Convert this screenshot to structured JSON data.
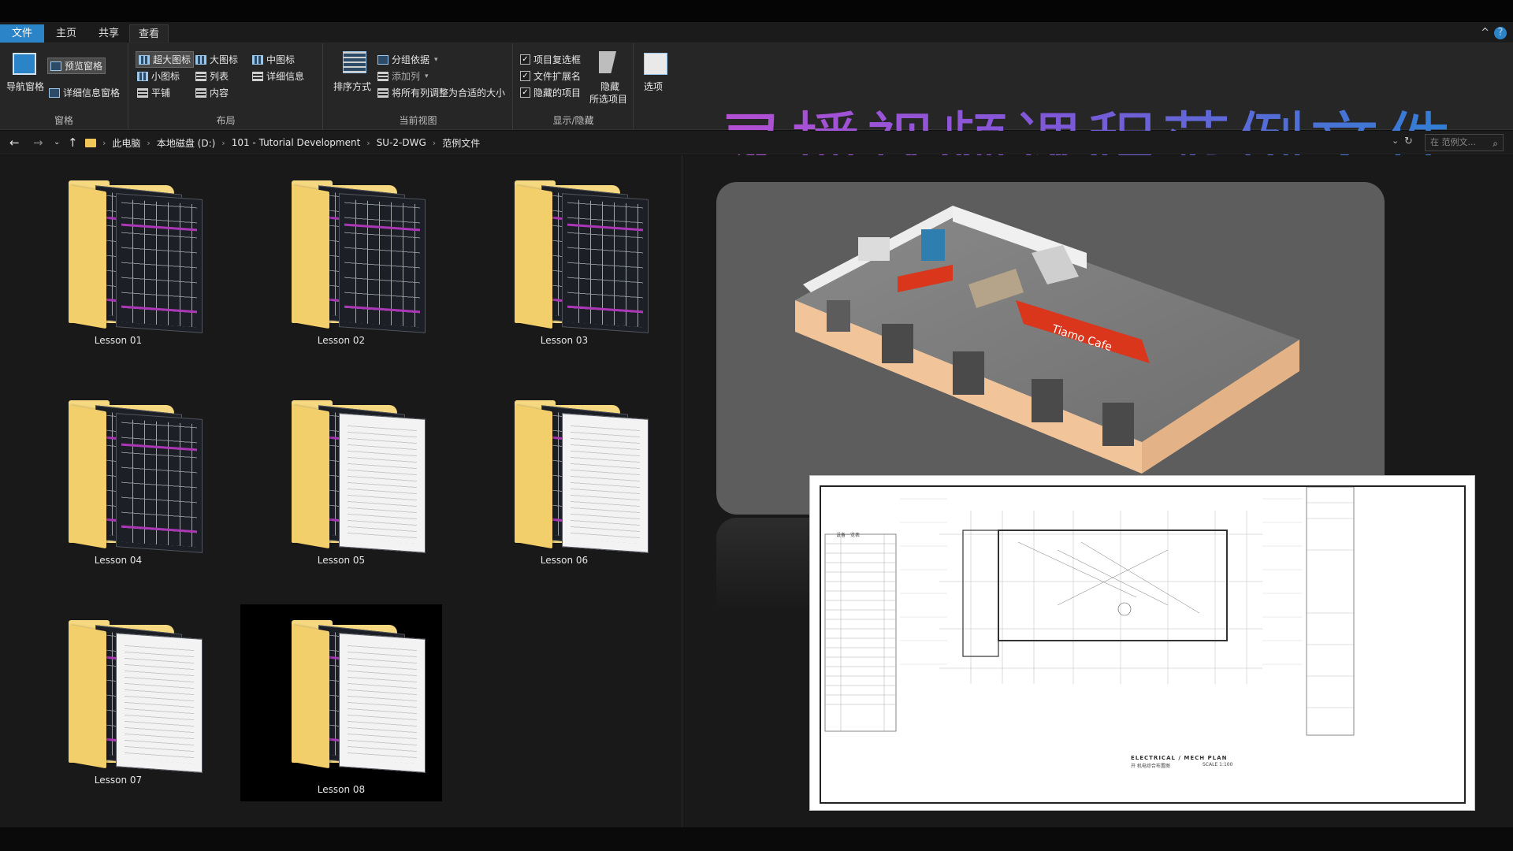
{
  "window": {
    "tabs": [
      {
        "label": "文件"
      },
      {
        "label": "主页"
      },
      {
        "label": "共享"
      },
      {
        "label": "查看"
      }
    ],
    "help_label": "?",
    "collapse_label": "^"
  },
  "ribbon": {
    "pane_group": {
      "label": "窗格",
      "nav_pane": "导航窗格",
      "preview_pane": "预览窗格",
      "details_pane": "详细信息窗格"
    },
    "layout_group": {
      "label": "布局",
      "items": [
        "超大图标",
        "大图标",
        "中图标",
        "小图标",
        "列表",
        "详细信息",
        "平铺",
        "内容"
      ]
    },
    "current_view_group": {
      "label": "当前视图",
      "sort_by": "排序方式",
      "group_by": "分组依据",
      "add_columns": "添加列",
      "size_all_columns": "将所有列调整为合适的大小"
    },
    "show_hide_group": {
      "label": "显示/隐藏",
      "item_checkboxes": "项目复选框",
      "file_extensions": "文件扩展名",
      "hidden_items": "隐藏的项目",
      "hide_selected": "隐藏",
      "hide_selected_sub": "所选项目"
    },
    "options": "选项"
  },
  "banner_text": "录播视频课程范例文件",
  "address": {
    "crumbs": [
      "此电脑",
      "本地磁盘 (D:)",
      "101 - Tutorial Development",
      "SU-2-DWG",
      "范例文件"
    ],
    "search_placeholder": "在 范例文..."
  },
  "folders": [
    {
      "label": "Lesson 01",
      "variant": "cad"
    },
    {
      "label": "Lesson 02",
      "variant": "cad"
    },
    {
      "label": "Lesson 03",
      "variant": "cad"
    },
    {
      "label": "Lesson 04",
      "variant": "cad"
    },
    {
      "label": "Lesson 05",
      "variant": "paper"
    },
    {
      "label": "Lesson 06",
      "variant": "paper"
    },
    {
      "label": "Lesson 07",
      "variant": "paper"
    },
    {
      "label": "Lesson 08",
      "variant": "paper",
      "selected": true
    }
  ],
  "preview": {
    "render_sign": "Tiamo Cafe",
    "drawing_title": "ELECTRICAL / MECH PLAN",
    "drawing_subtitle": "开 机电综合布置图",
    "drawing_scale": "SCALE 1:100",
    "legend_title": "设备一览表"
  }
}
